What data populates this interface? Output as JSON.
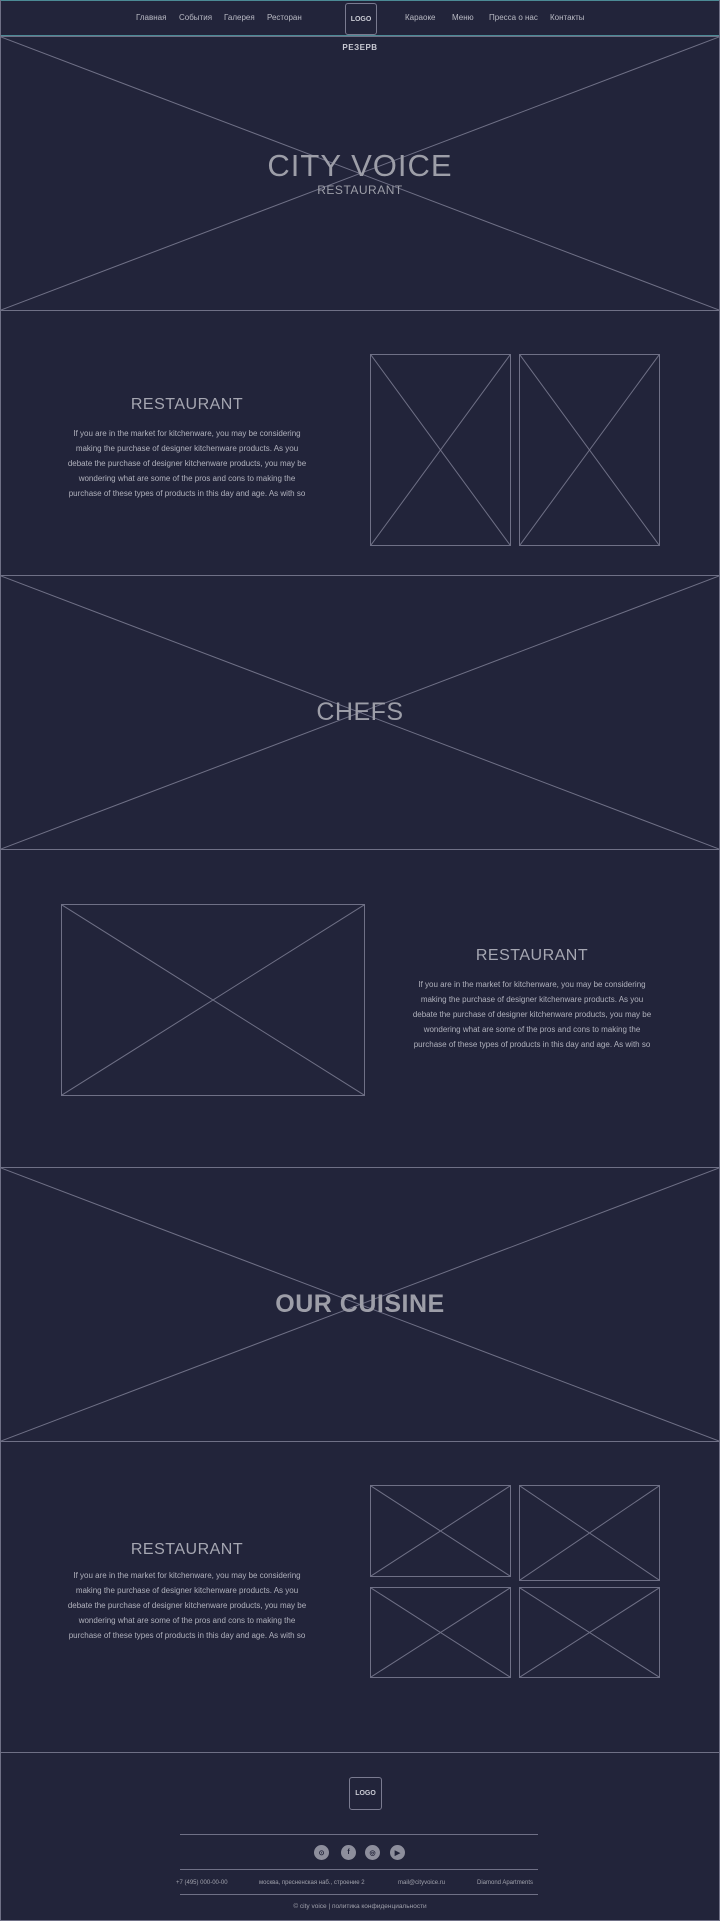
{
  "header": {
    "nav_left": [
      "Главная",
      "События",
      "Галерея",
      "Ресторан"
    ],
    "logo": "LOGO",
    "nav_right": [
      "Караоке",
      "Меню",
      "Пресса о нас",
      "Контакты"
    ],
    "reserve": "РЕЗЕРВ"
  },
  "hero": {
    "title": "CITY VOICE",
    "subtitle": "RESTAURANT"
  },
  "about1": {
    "heading": "RESTAURANT",
    "lines": [
      "If you are in the market for kitchenware, you may be considering",
      "making the purchase of designer kitchenware products. As you",
      "debate the purchase of designer kitchenware products, you may be",
      "wondering what are some of the pros and cons to making the",
      "purchase of these types of products in this day and age. As with so"
    ]
  },
  "chefs": {
    "title": "CHEFS"
  },
  "about2": {
    "heading": "RESTAURANT",
    "lines": [
      "If you are in the market for kitchenware, you may be considering",
      "making the purchase of designer kitchenware products. As you",
      "debate the purchase of designer kitchenware products, you may be",
      "wondering what are some of the pros and cons to making the",
      "purchase of these types of products in this day and age. As with so"
    ]
  },
  "cuisine": {
    "title": "OUR CUISINE"
  },
  "about3": {
    "heading": "RESTAURANT",
    "lines": [
      "If you are in the market for kitchenware, you may be considering",
      "making the purchase of designer kitchenware products. As you",
      "debate the purchase of designer kitchenware products, you may be",
      "wondering what are some of the pros and cons to making the",
      "purchase of these types of products in this day and age. As with so"
    ]
  },
  "footer": {
    "logo": "LOGO",
    "social": [
      {
        "icon": "tripadvisor-icon",
        "glyph": "⊙"
      },
      {
        "icon": "facebook-icon",
        "glyph": "f"
      },
      {
        "icon": "instagram-icon",
        "glyph": "◎"
      },
      {
        "icon": "youtube-icon",
        "glyph": "▶"
      }
    ],
    "phone": "+7 (495) 000-00-00",
    "address": "москва, пресненская наб., строение 2",
    "email": "mail@cityvoice.ru",
    "place": "Diamond Apartments",
    "copyright": "© city voice | политика конфиденциальности"
  },
  "colors": {
    "background": "#22243a",
    "lines": "#6f7086",
    "text": "#b9bac4"
  }
}
